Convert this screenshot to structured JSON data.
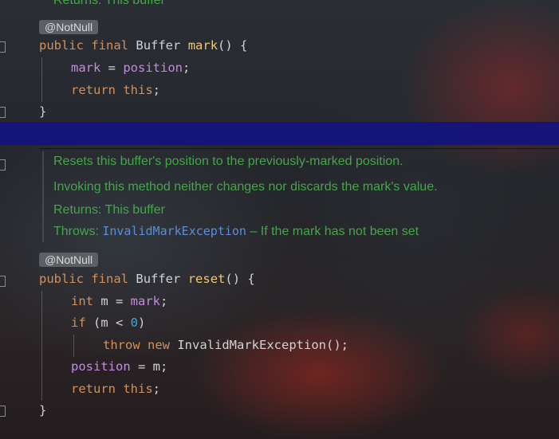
{
  "top_partial_doc": "Returns: This buffer",
  "mark_method": {
    "annotation": "@NotNull",
    "sig_kw1": "public",
    "sig_kw2": "final",
    "sig_type": "Buffer",
    "sig_name": "mark",
    "sig_rest": "() {",
    "line2_field": "mark",
    "line2_op": " = ",
    "line2_field2": "position",
    "line2_end": ";",
    "line3_kw1": "return",
    "line3_kw2": "this",
    "line3_end": ";",
    "close": "}"
  },
  "reset_doc": {
    "line1": "Resets this buffer's position to the previously-marked position.",
    "line2": "Invoking this method neither changes nor discards the mark's value.",
    "returns": "Returns: This buffer",
    "throws_label": "Throws: ",
    "throws_link": "InvalidMarkException",
    "throws_text": " – If the mark has not been set"
  },
  "reset_method": {
    "annotation": "@NotNull",
    "sig_kw1": "public",
    "sig_kw2": "final",
    "sig_type": "Buffer",
    "sig_name": "reset",
    "sig_rest": "() {",
    "l2_kw": "int",
    "l2_mid": " m = ",
    "l2_field": "mark",
    "l2_end": ";",
    "l3_kw": "if",
    "l3_mid": " (m < ",
    "l3_num": "0",
    "l3_end": ")",
    "l4_kw1": "throw",
    "l4_kw2": "new",
    "l4_rest": " InvalidMarkException();",
    "l5_field": "position",
    "l5_rest": " = m;",
    "l6_kw1": "return",
    "l6_kw2": "this",
    "l6_end": ";",
    "close": "}"
  }
}
